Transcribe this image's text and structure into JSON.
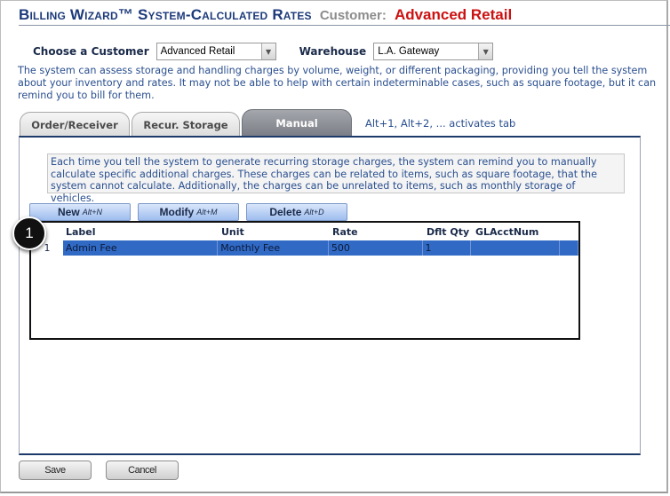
{
  "header": {
    "title": "Billing Wizard™ System-Calculated Rates",
    "customer_label": "Customer:",
    "customer_name": "Advanced Retail"
  },
  "filters": {
    "customer_label": "Choose a Customer",
    "customer_value": "Advanced Retail",
    "warehouse_label": "Warehouse",
    "warehouse_value": "L.A. Gateway"
  },
  "intro_text": "The system can assess storage and handling charges by volume, weight, or different packaging, providing you tell the system about your inventory and rates. It may not be able to help with certain indeterminable cases, such as square footage, but it can remind you to bill for them.",
  "tabs": [
    {
      "label": "Order/Receiver",
      "active": false
    },
    {
      "label": "Recur. Storage",
      "active": false
    },
    {
      "label": "Manual",
      "active": true
    }
  ],
  "tab_hint": "Alt+1, Alt+2, ... activates tab",
  "manual": {
    "info_text": "Each time you tell the system to generate recurring storage charges, the system can remind you to manually calculate specific additional charges. These charges can be related to items, such as square footage, that the system cannot calculate. Additionally, the charges can be unrelated to items, such as monthly storage of vehicles.",
    "buttons": [
      {
        "label": "New",
        "hotkey": "Alt+N"
      },
      {
        "label": "Modify",
        "hotkey": "Alt+M"
      },
      {
        "label": "Delete",
        "hotkey": "Alt+D"
      }
    ],
    "grid": {
      "columns": [
        "",
        "Label",
        "Unit",
        "Rate",
        "Dflt Qty",
        "GLAcctNum"
      ],
      "rows": [
        {
          "num": "1",
          "label": "Admin Fee",
          "unit": "Monthly Fee",
          "rate": "500",
          "dflt_qty": "1",
          "gl_acct_num": "",
          "selected": true
        }
      ]
    }
  },
  "callout_number": "1",
  "footer": {
    "save_label": "Save",
    "cancel_label": "Cancel"
  }
}
